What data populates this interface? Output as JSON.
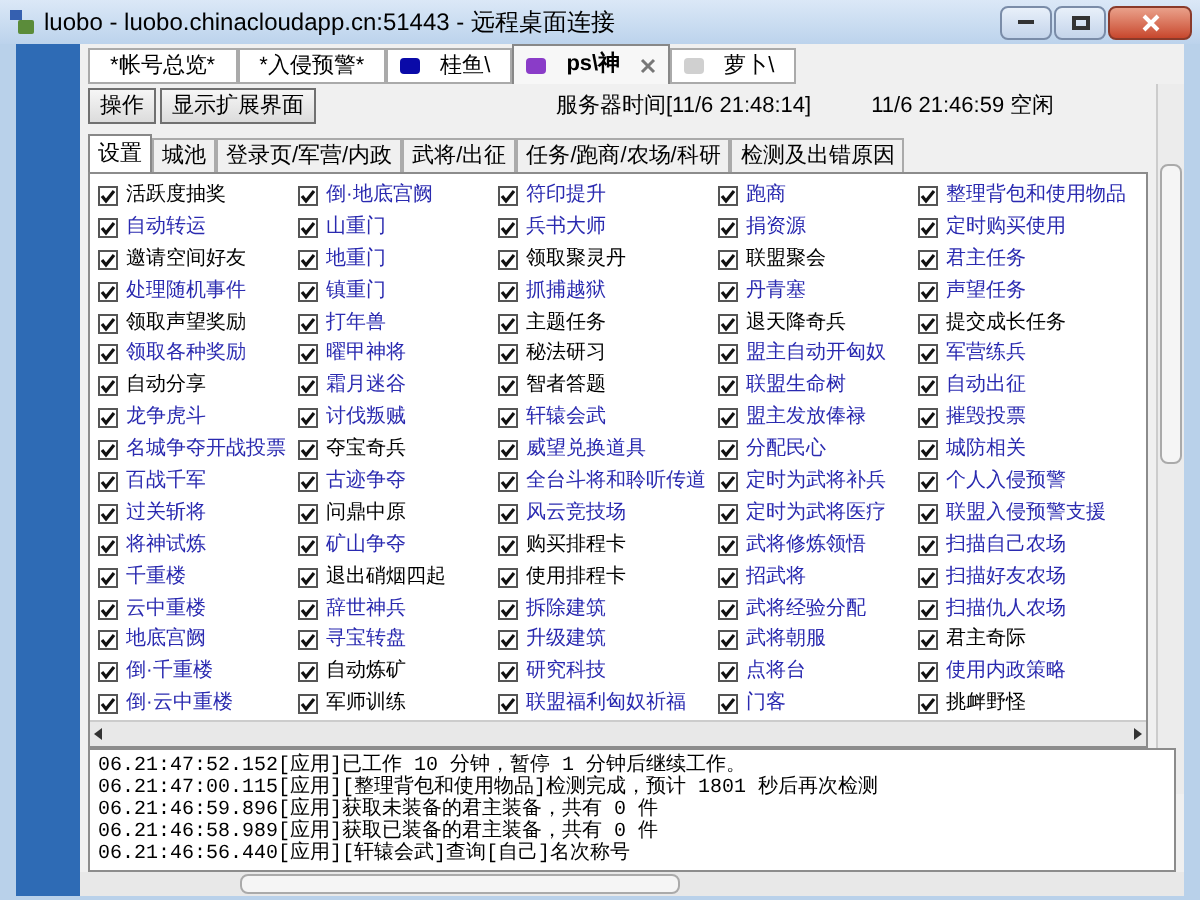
{
  "window": {
    "title": "luobo - luobo.chinacloudapp.cn:51443 - 远程桌面连接"
  },
  "account_tabs": [
    {
      "label": "*帐号总览*",
      "selected": false,
      "closable": false
    },
    {
      "label": "*入侵预警*",
      "selected": false,
      "closable": false
    },
    {
      "label": "桂鱼\\",
      "selected": false,
      "closable": false,
      "color": "#0a0aa8"
    },
    {
      "label": "ps\\神",
      "selected": true,
      "closable": true,
      "color": "#8a3cc8"
    },
    {
      "label": "萝卜\\",
      "selected": false,
      "closable": false,
      "color": "#d0d0d0"
    }
  ],
  "toolbar": {
    "buttons": [
      "操作",
      "显示扩展界面"
    ],
    "server_time": "服务器时间[11/6 21:48:14]",
    "status": "11/6 21:46:59 空闲"
  },
  "tabs": [
    {
      "label": "设置",
      "selected": true
    },
    {
      "label": "城池",
      "selected": false
    },
    {
      "label": "登录页/军营/内政",
      "selected": false
    },
    {
      "label": "武将/出征",
      "selected": false
    },
    {
      "label": "任务/跑商/农场/科研",
      "selected": false
    },
    {
      "label": "检测及出错原因",
      "selected": false
    }
  ],
  "settings": {
    "columns": [
      {
        "items": [
          {
            "label": "活跃度抽奖",
            "checked": true,
            "color": "#000000"
          },
          {
            "label": "自动转运",
            "checked": true,
            "color": "#2a2ab0"
          },
          {
            "label": "邀请空间好友",
            "checked": true,
            "color": "#000000"
          },
          {
            "label": "处理随机事件",
            "checked": true,
            "color": "#2a2ab0"
          },
          {
            "label": "领取声望奖励",
            "checked": true,
            "color": "#000000"
          },
          {
            "label": "领取各种奖励",
            "checked": true,
            "color": "#2a2ab0"
          },
          {
            "label": "自动分享",
            "checked": true,
            "color": "#000000"
          },
          {
            "label": "龙争虎斗",
            "checked": true,
            "color": "#2a2ab0"
          },
          {
            "label": "名城争夺开战投票",
            "checked": true,
            "color": "#2a2ab0"
          },
          {
            "label": "百战千军",
            "checked": true,
            "color": "#2a2ab0"
          },
          {
            "label": "过关斩将",
            "checked": true,
            "color": "#2a2ab0"
          },
          {
            "label": "将神试炼",
            "checked": true,
            "color": "#2a2ab0"
          },
          {
            "label": "千重楼",
            "checked": true,
            "color": "#2a2ab0"
          },
          {
            "label": "云中重楼",
            "checked": true,
            "color": "#2a2ab0"
          },
          {
            "label": "地底宫阙",
            "checked": true,
            "color": "#2a2ab0"
          },
          {
            "label": "倒·千重楼",
            "checked": true,
            "color": "#2a2ab0"
          },
          {
            "label": "倒·云中重楼",
            "checked": true,
            "color": "#2a2ab0"
          }
        ]
      },
      {
        "items": [
          {
            "label": "倒·地底宫阙",
            "checked": true,
            "color": "#2a2ab0"
          },
          {
            "label": "山重门",
            "checked": true,
            "color": "#2a2ab0"
          },
          {
            "label": "地重门",
            "checked": true,
            "color": "#2a2ab0"
          },
          {
            "label": "镇重门",
            "checked": true,
            "color": "#2a2ab0"
          },
          {
            "label": "打年兽",
            "checked": true,
            "color": "#2a2ab0"
          },
          {
            "label": "曜甲神将",
            "checked": true,
            "color": "#2a2ab0"
          },
          {
            "label": "霜月迷谷",
            "checked": true,
            "color": "#2a2ab0"
          },
          {
            "label": "讨伐叛贼",
            "checked": true,
            "color": "#2a2ab0"
          },
          {
            "label": "夺宝奇兵",
            "checked": true,
            "color": "#000000"
          },
          {
            "label": "古迹争夺",
            "checked": true,
            "color": "#2a2ab0"
          },
          {
            "label": "问鼎中原",
            "checked": true,
            "color": "#000000"
          },
          {
            "label": "矿山争夺",
            "checked": true,
            "color": "#2a2ab0"
          },
          {
            "label": "退出硝烟四起",
            "checked": true,
            "color": "#000000"
          },
          {
            "label": "辞世神兵",
            "checked": true,
            "color": "#2a2ab0"
          },
          {
            "label": "寻宝转盘",
            "checked": true,
            "color": "#2a2ab0"
          },
          {
            "label": "自动炼矿",
            "checked": true,
            "color": "#000000"
          },
          {
            "label": "军师训练",
            "checked": true,
            "color": "#000000"
          }
        ]
      },
      {
        "items": [
          {
            "label": "符印提升",
            "checked": true,
            "color": "#2a2ab0"
          },
          {
            "label": "兵书大师",
            "checked": true,
            "color": "#2a2ab0"
          },
          {
            "label": "领取聚灵丹",
            "checked": true,
            "color": "#000000"
          },
          {
            "label": "抓捕越狱",
            "checked": true,
            "color": "#2a2ab0"
          },
          {
            "label": "主题任务",
            "checked": true,
            "color": "#000000"
          },
          {
            "label": "秘法研习",
            "checked": true,
            "color": "#000000"
          },
          {
            "label": "智者答题",
            "checked": true,
            "color": "#000000"
          },
          {
            "label": "轩辕会武",
            "checked": true,
            "color": "#2a2ab0"
          },
          {
            "label": "威望兑换道具",
            "checked": true,
            "color": "#2a2ab0"
          },
          {
            "label": "全台斗将和聆听传道",
            "checked": true,
            "color": "#2a2ab0"
          },
          {
            "label": "风云竞技场",
            "checked": true,
            "color": "#2a2ab0"
          },
          {
            "label": "购买排程卡",
            "checked": true,
            "color": "#000000"
          },
          {
            "label": "使用排程卡",
            "checked": true,
            "color": "#000000"
          },
          {
            "label": "拆除建筑",
            "checked": true,
            "color": "#2a2ab0"
          },
          {
            "label": "升级建筑",
            "checked": true,
            "color": "#2a2ab0"
          },
          {
            "label": "研究科技",
            "checked": true,
            "color": "#2a2ab0"
          },
          {
            "label": "联盟福利匈奴祈福",
            "checked": true,
            "color": "#2a2ab0"
          }
        ]
      },
      {
        "items": [
          {
            "label": "跑商",
            "checked": true,
            "color": "#2a2ab0"
          },
          {
            "label": "捐资源",
            "checked": true,
            "color": "#2a2ab0"
          },
          {
            "label": "联盟聚会",
            "checked": true,
            "color": "#000000"
          },
          {
            "label": "丹青塞",
            "checked": true,
            "color": "#2a2ab0"
          },
          {
            "label": "退天降奇兵",
            "checked": true,
            "color": "#000000"
          },
          {
            "label": "盟主自动开匈奴",
            "checked": true,
            "color": "#2a2ab0"
          },
          {
            "label": "联盟生命树",
            "checked": true,
            "color": "#2a2ab0"
          },
          {
            "label": "盟主发放俸禄",
            "checked": true,
            "color": "#2a2ab0"
          },
          {
            "label": "分配民心",
            "checked": true,
            "color": "#2a2ab0"
          },
          {
            "label": "定时为武将补兵",
            "checked": true,
            "color": "#2a2ab0"
          },
          {
            "label": "定时为武将医疗",
            "checked": true,
            "color": "#2a2ab0"
          },
          {
            "label": "武将修炼领悟",
            "checked": true,
            "color": "#2a2ab0"
          },
          {
            "label": "招武将",
            "checked": true,
            "color": "#2a2ab0"
          },
          {
            "label": "武将经验分配",
            "checked": true,
            "color": "#2a2ab0"
          },
          {
            "label": "武将朝服",
            "checked": true,
            "color": "#2a2ab0"
          },
          {
            "label": "点将台",
            "checked": true,
            "color": "#2a2ab0"
          },
          {
            "label": "门客",
            "checked": true,
            "color": "#2a2ab0"
          }
        ]
      },
      {
        "items": [
          {
            "label": "整理背包和使用物品",
            "checked": true,
            "color": "#2a2ab0"
          },
          {
            "label": "定时购买使用",
            "checked": true,
            "color": "#2a2ab0"
          },
          {
            "label": "君主任务",
            "checked": true,
            "color": "#2a2ab0"
          },
          {
            "label": "声望任务",
            "checked": true,
            "color": "#2a2ab0"
          },
          {
            "label": "提交成长任务",
            "checked": true,
            "color": "#000000"
          },
          {
            "label": "军营练兵",
            "checked": true,
            "color": "#2a2ab0"
          },
          {
            "label": "自动出征",
            "checked": true,
            "color": "#2a2ab0"
          },
          {
            "label": "摧毁投票",
            "checked": true,
            "color": "#2a2ab0"
          },
          {
            "label": "城防相关",
            "checked": true,
            "color": "#2a2ab0"
          },
          {
            "label": "个人入侵预警",
            "checked": true,
            "color": "#2a2ab0"
          },
          {
            "label": "联盟入侵预警支援",
            "checked": true,
            "color": "#2a2ab0"
          },
          {
            "label": "扫描自己农场",
            "checked": true,
            "color": "#2a2ab0"
          },
          {
            "label": "扫描好友农场",
            "checked": true,
            "color": "#2a2ab0"
          },
          {
            "label": "扫描仇人农场",
            "checked": true,
            "color": "#2a2ab0"
          },
          {
            "label": "君主奇际",
            "checked": true,
            "color": "#000000"
          },
          {
            "label": "使用内政策略",
            "checked": true,
            "color": "#2a2ab0"
          },
          {
            "label": "挑衅野怪",
            "checked": true,
            "color": "#000000"
          }
        ]
      }
    ]
  },
  "log": [
    "06.21:47:52.152[应用]已工作 10 分钟，暂停 1 分钟后继续工作。",
    "06.21:47:00.115[应用][整理背包和使用物品]检测完成，预计 1801 秒后再次检测",
    "06.21:46:59.896[应用]获取未装备的君主装备，共有 0 件",
    "06.21:46:58.989[应用]获取已装备的君主装备，共有 0 件",
    "06.21:46:56.440[应用][轩辕会武]查询[自己]名次称号"
  ]
}
